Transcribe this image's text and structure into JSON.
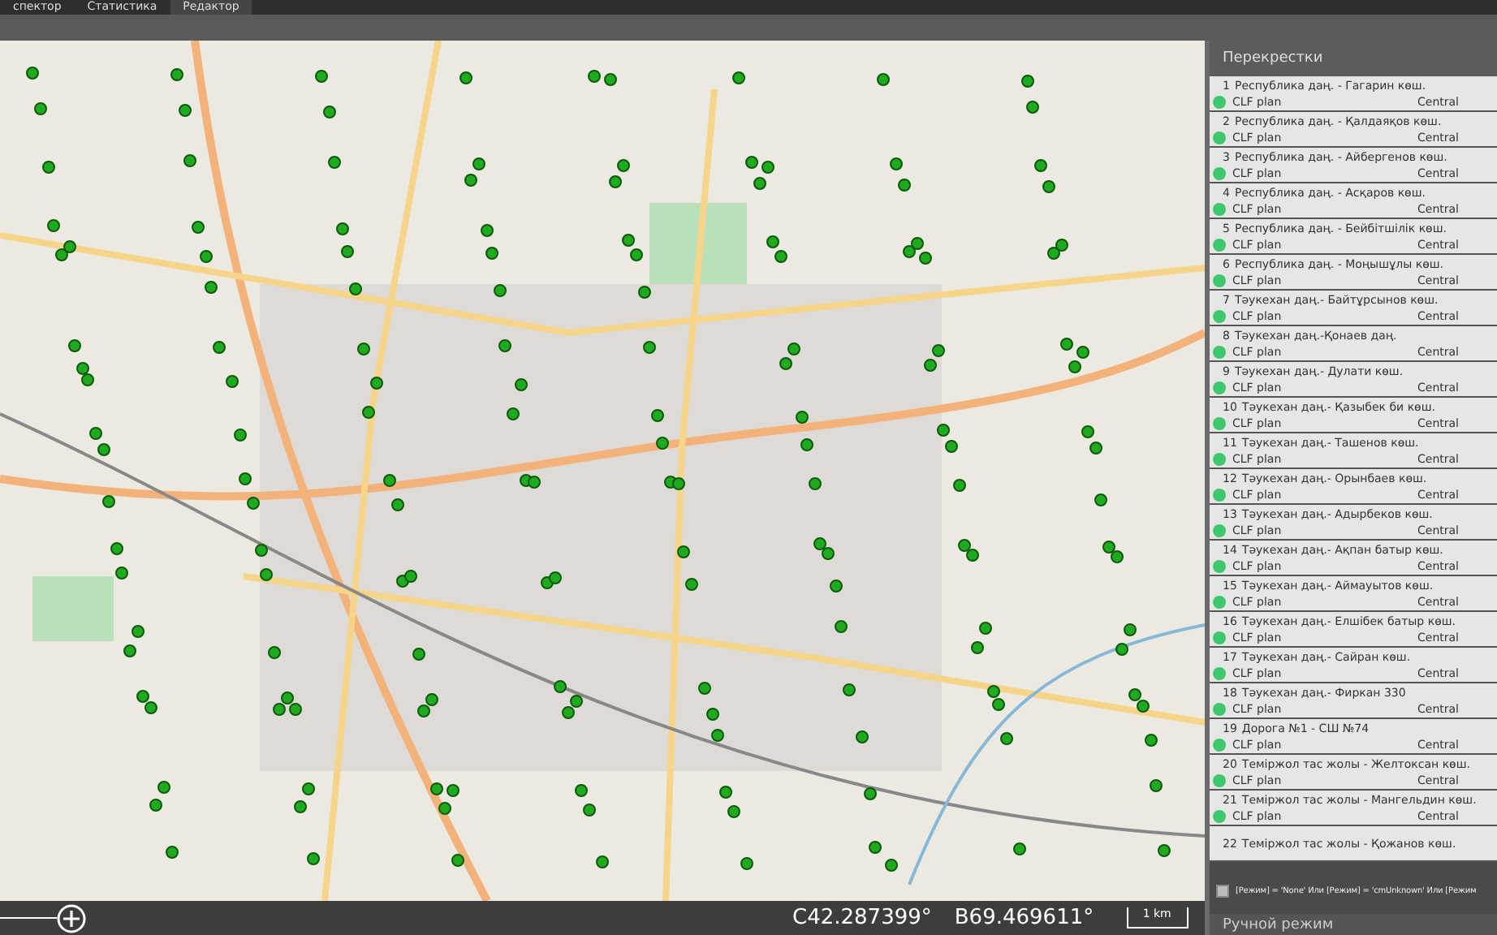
{
  "menu": {
    "tabs": [
      {
        "label": "спектор",
        "selected": false
      },
      {
        "label": "Статистика",
        "selected": false
      },
      {
        "label": "Редактор",
        "selected": true
      }
    ]
  },
  "panel": {
    "title": "Перекрестки",
    "intersections": [
      {
        "number": "1",
        "name": "Республика даң. - Гагарин көш.",
        "plan": "CLF plan",
        "mode": "Central",
        "color": "#3ec86e"
      },
      {
        "number": "2",
        "name": "Республика даң. - Қалдаяқов көш.",
        "plan": "CLF plan",
        "mode": "Central",
        "color": "#3ec86e"
      },
      {
        "number": "3",
        "name": "Республика даң. - Айбергенов көш.",
        "plan": "CLF plan",
        "mode": "Central",
        "color": "#3ec86e"
      },
      {
        "number": "4",
        "name": "Республика даң. - Асқаров  көш.",
        "plan": "CLF plan",
        "mode": "Central",
        "color": "#3ec86e"
      },
      {
        "number": "5",
        "name": "Республика даң. - Бейбітшілік  көш.",
        "plan": "CLF plan",
        "mode": "Central",
        "color": "#3ec86e"
      },
      {
        "number": "6",
        "name": "Республика даң. - Моңышұлы көш.",
        "plan": "CLF plan",
        "mode": "Central",
        "color": "#3ec86e"
      },
      {
        "number": "7",
        "name": "Тәукехан даң.- Байтұрсынов көш.",
        "plan": "CLF plan",
        "mode": "Central",
        "color": "#3ec86e"
      },
      {
        "number": "8",
        "name": "Тәукехан даң.-Қонаев даң.",
        "plan": "CLF plan",
        "mode": "Central",
        "color": "#3ec86e"
      },
      {
        "number": "9",
        "name": "Тәукехан даң.- Дулати көш.",
        "plan": "CLF plan",
        "mode": "Central",
        "color": "#3ec86e"
      },
      {
        "number": "10",
        "name": "Тәукехан даң.- Қазыбек би көш.",
        "plan": "CLF plan",
        "mode": "Central",
        "color": "#3ec86e"
      },
      {
        "number": "11",
        "name": "Тәукехан даң.- Ташенов көш.",
        "plan": "CLF plan",
        "mode": "Central",
        "color": "#3ec86e"
      },
      {
        "number": "12",
        "name": "Тәукехан даң.- Орынбаев көш.",
        "plan": "CLF plan",
        "mode": "Central",
        "color": "#3ec86e"
      },
      {
        "number": "13",
        "name": "Тәукехан даң.- Адырбеков көш.",
        "plan": "CLF plan",
        "mode": "Central",
        "color": "#3ec86e"
      },
      {
        "number": "14",
        "name": "Тәукехан даң.- Ақпан батыр көш.",
        "plan": "CLF plan",
        "mode": "Central",
        "color": "#3ec86e"
      },
      {
        "number": "15",
        "name": "Тәукехан даң.- Аймауытов  көш.",
        "plan": "CLF plan",
        "mode": "Central",
        "color": "#3ec86e"
      },
      {
        "number": "16",
        "name": "Тәукехан даң.- Елшібек батыр көш.",
        "plan": "CLF plan",
        "mode": "Central",
        "color": "#3ec86e"
      },
      {
        "number": "17",
        "name": "Тәукехан даң.- Сайран көш.",
        "plan": "CLF plan",
        "mode": "Central",
        "color": "#3ec86e"
      },
      {
        "number": "18",
        "name": "Тәукехан даң.- Фиркан 330",
        "plan": "CLF plan",
        "mode": "Central",
        "color": "#3ec86e"
      },
      {
        "number": "19",
        "name": "Дорога №1 - СШ №74",
        "plan": "CLF plan",
        "mode": "Central",
        "color": "#3ec86e"
      },
      {
        "number": "20",
        "name": "Теміржол тас жолы - Желтоксан көш.",
        "plan": "CLF plan",
        "mode": "Central",
        "color": "#3ec86e"
      },
      {
        "number": "21",
        "name": "Теміржол тас жолы - Мангельдин  көш.",
        "plan": "CLF plan",
        "mode": "Central",
        "color": "#3ec86e"
      },
      {
        "number": "22",
        "name": "Теміржол тас жолы - Қожанов көш."
      }
    ],
    "filter": {
      "checked": false,
      "text": "[Режим] = 'None' Или [Режим] = 'cmUnknown' Или [Режим"
    },
    "manual_mode": "Ручной режим"
  },
  "status_bar": {
    "latitude": "С42.287399°",
    "longitude": "В69.469611°",
    "scale": "1 km"
  }
}
